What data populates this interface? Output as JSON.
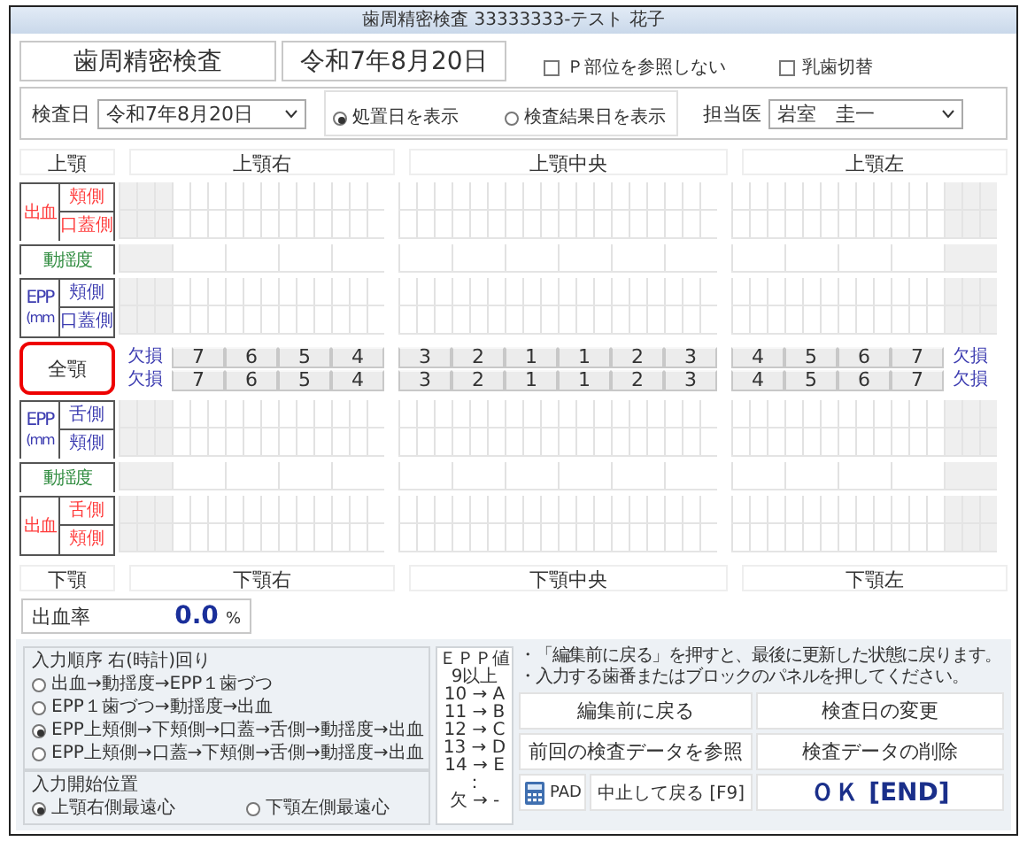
{
  "window": {
    "title": "歯周精密検査 33333333-テスト 花子"
  },
  "header": {
    "exam_name": "歯周精密検査",
    "exam_date": "令和7年8月20日",
    "checkboxes": [
      {
        "label": "Ｐ部位を参照しない",
        "checked": false
      },
      {
        "label": "乳歯切替",
        "checked": false
      }
    ]
  },
  "filter": {
    "date_label": "検査日",
    "date_value": "令和7年8月20日",
    "radios": [
      {
        "label": "処置日を表示",
        "selected": true
      },
      {
        "label": "検査結果日を表示",
        "selected": false
      }
    ],
    "doctor_label": "担当医",
    "doctor_value": "岩室　圭一"
  },
  "upper": {
    "headers": [
      "上顎",
      "上顎右",
      "上顎中央",
      "上顎左"
    ],
    "groups": [
      {
        "kind": "bleeding",
        "label": "出血",
        "rows": [
          "頬側",
          "口蓋側"
        ]
      },
      {
        "kind": "mobility",
        "label": "動揺度"
      },
      {
        "kind": "epp",
        "label": "EPP",
        "note": "(mm",
        "rows": [
          "頬側",
          "口蓋側"
        ]
      }
    ]
  },
  "teeth": {
    "full_jaw_button": {
      "label": "全顎",
      "highlighted": true
    },
    "rows": [
      {
        "blocks": [
          [
            {
              "label": "欠損",
              "disabled": true
            },
            {
              "label": "7",
              "disabled": false
            },
            {
              "label": "6",
              "disabled": false
            },
            {
              "label": "5",
              "disabled": false
            },
            {
              "label": "4",
              "disabled": false
            }
          ],
          [
            {
              "label": "3",
              "disabled": false
            },
            {
              "label": "2",
              "disabled": false
            },
            {
              "label": "1",
              "disabled": false
            },
            {
              "label": "1",
              "disabled": false
            },
            {
              "label": "2",
              "disabled": false
            },
            {
              "label": "3",
              "disabled": false
            }
          ],
          [
            {
              "label": "4",
              "disabled": false
            },
            {
              "label": "5",
              "disabled": false
            },
            {
              "label": "6",
              "disabled": false
            },
            {
              "label": "7",
              "disabled": false
            },
            {
              "label": "欠損",
              "disabled": true
            }
          ]
        ]
      },
      {
        "blocks": [
          [
            {
              "label": "欠損",
              "disabled": true
            },
            {
              "label": "7",
              "disabled": false
            },
            {
              "label": "6",
              "disabled": false
            },
            {
              "label": "5",
              "disabled": false
            },
            {
              "label": "4",
              "disabled": false
            }
          ],
          [
            {
              "label": "3",
              "disabled": false
            },
            {
              "label": "2",
              "disabled": false
            },
            {
              "label": "1",
              "disabled": false
            },
            {
              "label": "1",
              "disabled": false
            },
            {
              "label": "2",
              "disabled": false
            },
            {
              "label": "3",
              "disabled": false
            }
          ],
          [
            {
              "label": "4",
              "disabled": false
            },
            {
              "label": "5",
              "disabled": false
            },
            {
              "label": "6",
              "disabled": false
            },
            {
              "label": "7",
              "disabled": false
            },
            {
              "label": "欠損",
              "disabled": true
            }
          ]
        ]
      }
    ]
  },
  "lower": {
    "headers": [
      "下顎",
      "下顎右",
      "下顎中央",
      "下顎左"
    ],
    "groups": [
      {
        "kind": "epp",
        "label": "EPP",
        "note": "(mm",
        "rows": [
          "舌側",
          "頬側"
        ]
      },
      {
        "kind": "mobility",
        "label": "動揺度"
      },
      {
        "kind": "bleeding",
        "label": "出血",
        "rows": [
          "舌側",
          "頬側"
        ]
      }
    ]
  },
  "bleeding_rate": {
    "label": "出血率",
    "value": "0.0",
    "unit": "%"
  },
  "input_order": {
    "legend": "入力順序  右(時計)回り",
    "options": [
      {
        "label": "出血→動揺度→EPP１歯づつ",
        "selected": false
      },
      {
        "label": "EPP１歯づつ→動揺度→出血",
        "selected": false
      },
      {
        "label": "EPP上頬側→下頬側→口蓋→舌側→動揺度→出血",
        "selected": true
      },
      {
        "label": "EPP上頬側→口蓋→下頬側→舌側→動揺度→出血",
        "selected": false
      }
    ]
  },
  "start_position": {
    "legend": "入力開始位置",
    "options": [
      {
        "label": "上顎右側最遠心",
        "selected": true
      },
      {
        "label": "下顎左側最遠心",
        "selected": false
      }
    ]
  },
  "epp_legend": [
    "ＥＰＰ値",
    "9以上",
    "10 → A",
    "11 → B",
    "12 → C",
    "13 → D",
    "14 → E",
    "：",
    "欠 → -"
  ],
  "notes": [
    "・「編集前に戻る」を押すと、最後に更新した状態に戻ります。",
    "・入力する歯番またはブロックのパネルを押してください。"
  ],
  "buttons": [
    {
      "label": "編集前に戻る",
      "kind": "plain"
    },
    {
      "label": "検査日の変更",
      "kind": "plain"
    },
    {
      "label": "前回の検査データを参照",
      "kind": "plain"
    },
    {
      "label": "検査データの削除",
      "kind": "plain"
    },
    {
      "label": "PAD",
      "kind": "pad"
    },
    {
      "label": "中止して戻る [F9]",
      "kind": "plain"
    },
    {
      "label": "ＯＫ  [END]",
      "kind": "primary"
    }
  ]
}
